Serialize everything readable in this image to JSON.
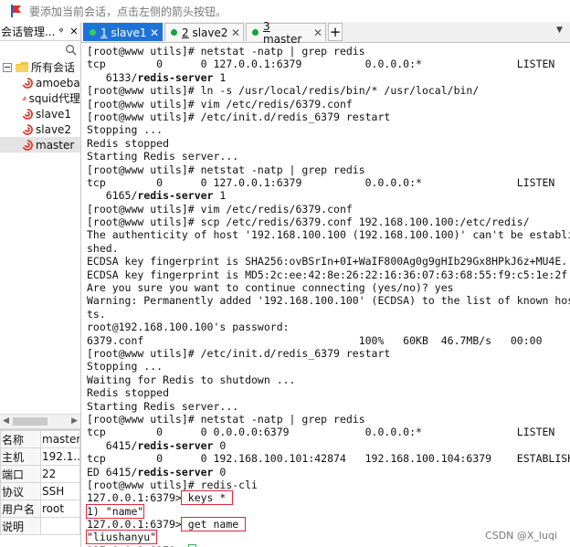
{
  "hint_bar": {
    "text": "要添加当前会话，点击左侧的箭头按钮。"
  },
  "session_panel": {
    "title": "会话管理...",
    "pin_glyph": "ᵠ",
    "close_glyph": "✕",
    "root": "所有会话",
    "items": [
      "amoeba",
      "squid代理",
      "slave1",
      "slave2",
      "master"
    ],
    "selected": "master"
  },
  "properties": [
    {
      "k": "名称",
      "v": "master"
    },
    {
      "k": "主机",
      "v": "192.1..."
    },
    {
      "k": "端口",
      "v": "22"
    },
    {
      "k": "协议",
      "v": "SSH"
    },
    {
      "k": "用户名",
      "v": "root"
    },
    {
      "k": "说明",
      "v": ""
    }
  ],
  "tabs": [
    {
      "num": "1",
      "label": "slave1",
      "active": true
    },
    {
      "num": "2",
      "label": "slave2",
      "active": false
    },
    {
      "num": "3",
      "label": "master",
      "active": false
    }
  ],
  "tab_add": "+",
  "tab_menu": "▼",
  "terminal": [
    "[root@www utils]# netstat -natp | grep redis",
    "tcp        0      0 127.0.0.1:6379          0.0.0.0:*               LISTEN",
    "   6133/redis-server 1",
    "[root@www utils]# ln -s /usr/local/redis/bin/* /usr/local/bin/",
    "[root@www utils]# vim /etc/redis/6379.conf",
    "[root@www utils]# /etc/init.d/redis_6379 restart",
    "Stopping ...",
    "Redis stopped",
    "Starting Redis server...",
    "[root@www utils]# netstat -natp | grep redis",
    "tcp        0      0 127.0.0.1:6379          0.0.0.0:*               LISTEN",
    "   6165/redis-server 1",
    "[root@www utils]# vim /etc/redis/6379.conf",
    "[root@www utils]# scp /etc/redis/6379.conf 192.168.100.100:/etc/redis/",
    "The authenticity of host '192.168.100.100 (192.168.100.100)' can't be establi",
    "shed.",
    "ECDSA key fingerprint is SHA256:ovBSrIn+0I+WaIF800Ag0g9gHIb29Gx8HPkJ6z+MU4E.",
    "ECDSA key fingerprint is MD5:2c:ee:42:8e:26:22:16:36:07:63:68:55:f9:c5:1e:2f.",
    "Are you sure you want to continue connecting (yes/no)? yes",
    "Warning: Permanently added '192.168.100.100' (ECDSA) to the list of known hos",
    "ts.",
    "root@192.168.100.100's password:",
    "6379.conf                                  100%   60KB  46.7MB/s   00:00",
    "[root@www utils]# /etc/init.d/redis_6379 restart",
    "Stopping ...",
    "Waiting for Redis to shutdown ...",
    "Redis stopped",
    "Starting Redis server...",
    "[root@www utils]# netstat -natp | grep redis",
    "tcp        0      0 0.0.0.0:6379            0.0.0.0:*               LISTEN",
    "   6415/redis-server 0",
    "tcp        0      0 192.168.100.101:42874   192.168.100.104:6379    ESTABLISH",
    "ED 6415/redis-server 0",
    "[root@www utils]# redis-cli",
    "127.0.0.1:6379> keys *",
    "1) \"name\"",
    "127.0.0.1:6379> get name",
    "\"liushanyu\"",
    "127.0.0.1:6379> "
  ],
  "watermark": "CSDN @X_luqi"
}
